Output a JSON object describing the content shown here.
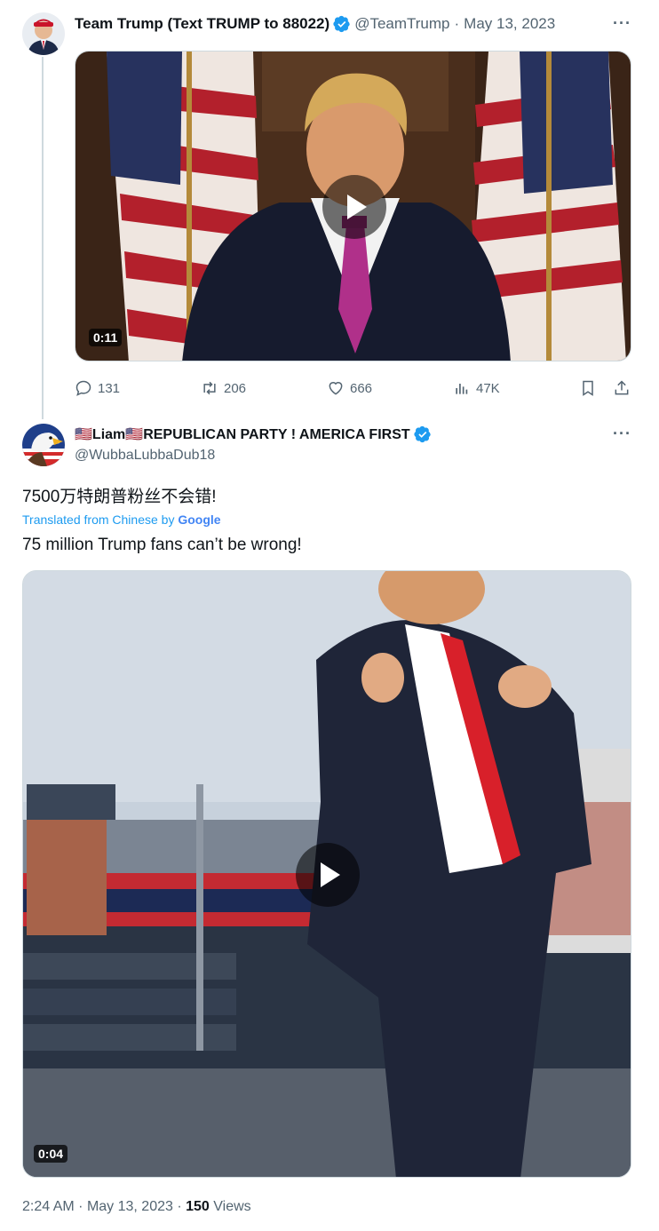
{
  "tweet1": {
    "display_name": "Team Trump (Text TRUMP to 88022)",
    "handle": "@TeamTrump",
    "separator": "·",
    "date": "May 13, 2023",
    "more": "···",
    "video": {
      "duration": "0:11"
    },
    "actions": {
      "replies": "131",
      "retweets": "206",
      "likes": "666",
      "views": "47K"
    }
  },
  "tweet2": {
    "display_name": "🇺🇸Liam🇺🇸REPUBLICAN PARTY ! AMERICA FIRST",
    "handle": "@WubbaLubbaDub18",
    "more": "···",
    "original_text": "7500万特朗普粉丝不会错!",
    "translated_prefix": "Translated from Chinese by",
    "translated_by": "Google",
    "translated_text": "75 million Trump fans can’t be wrong!",
    "video": {
      "duration": "0:04"
    },
    "footer": {
      "time": "2:24 AM",
      "separator": "·",
      "date": "May 13, 2023",
      "separator2": "·",
      "views_count": "150",
      "views_label": "Views"
    }
  },
  "colors": {
    "accent": "#1d9bf0",
    "text": "#0f1419",
    "muted": "#536471",
    "tie_purple": "#b0308a",
    "tie_red": "#d8202a"
  },
  "icons": [
    "reply-icon",
    "retweet-icon",
    "like-icon",
    "views-icon",
    "bookmark-icon",
    "share-icon",
    "verified-badge-icon",
    "play-icon"
  ]
}
